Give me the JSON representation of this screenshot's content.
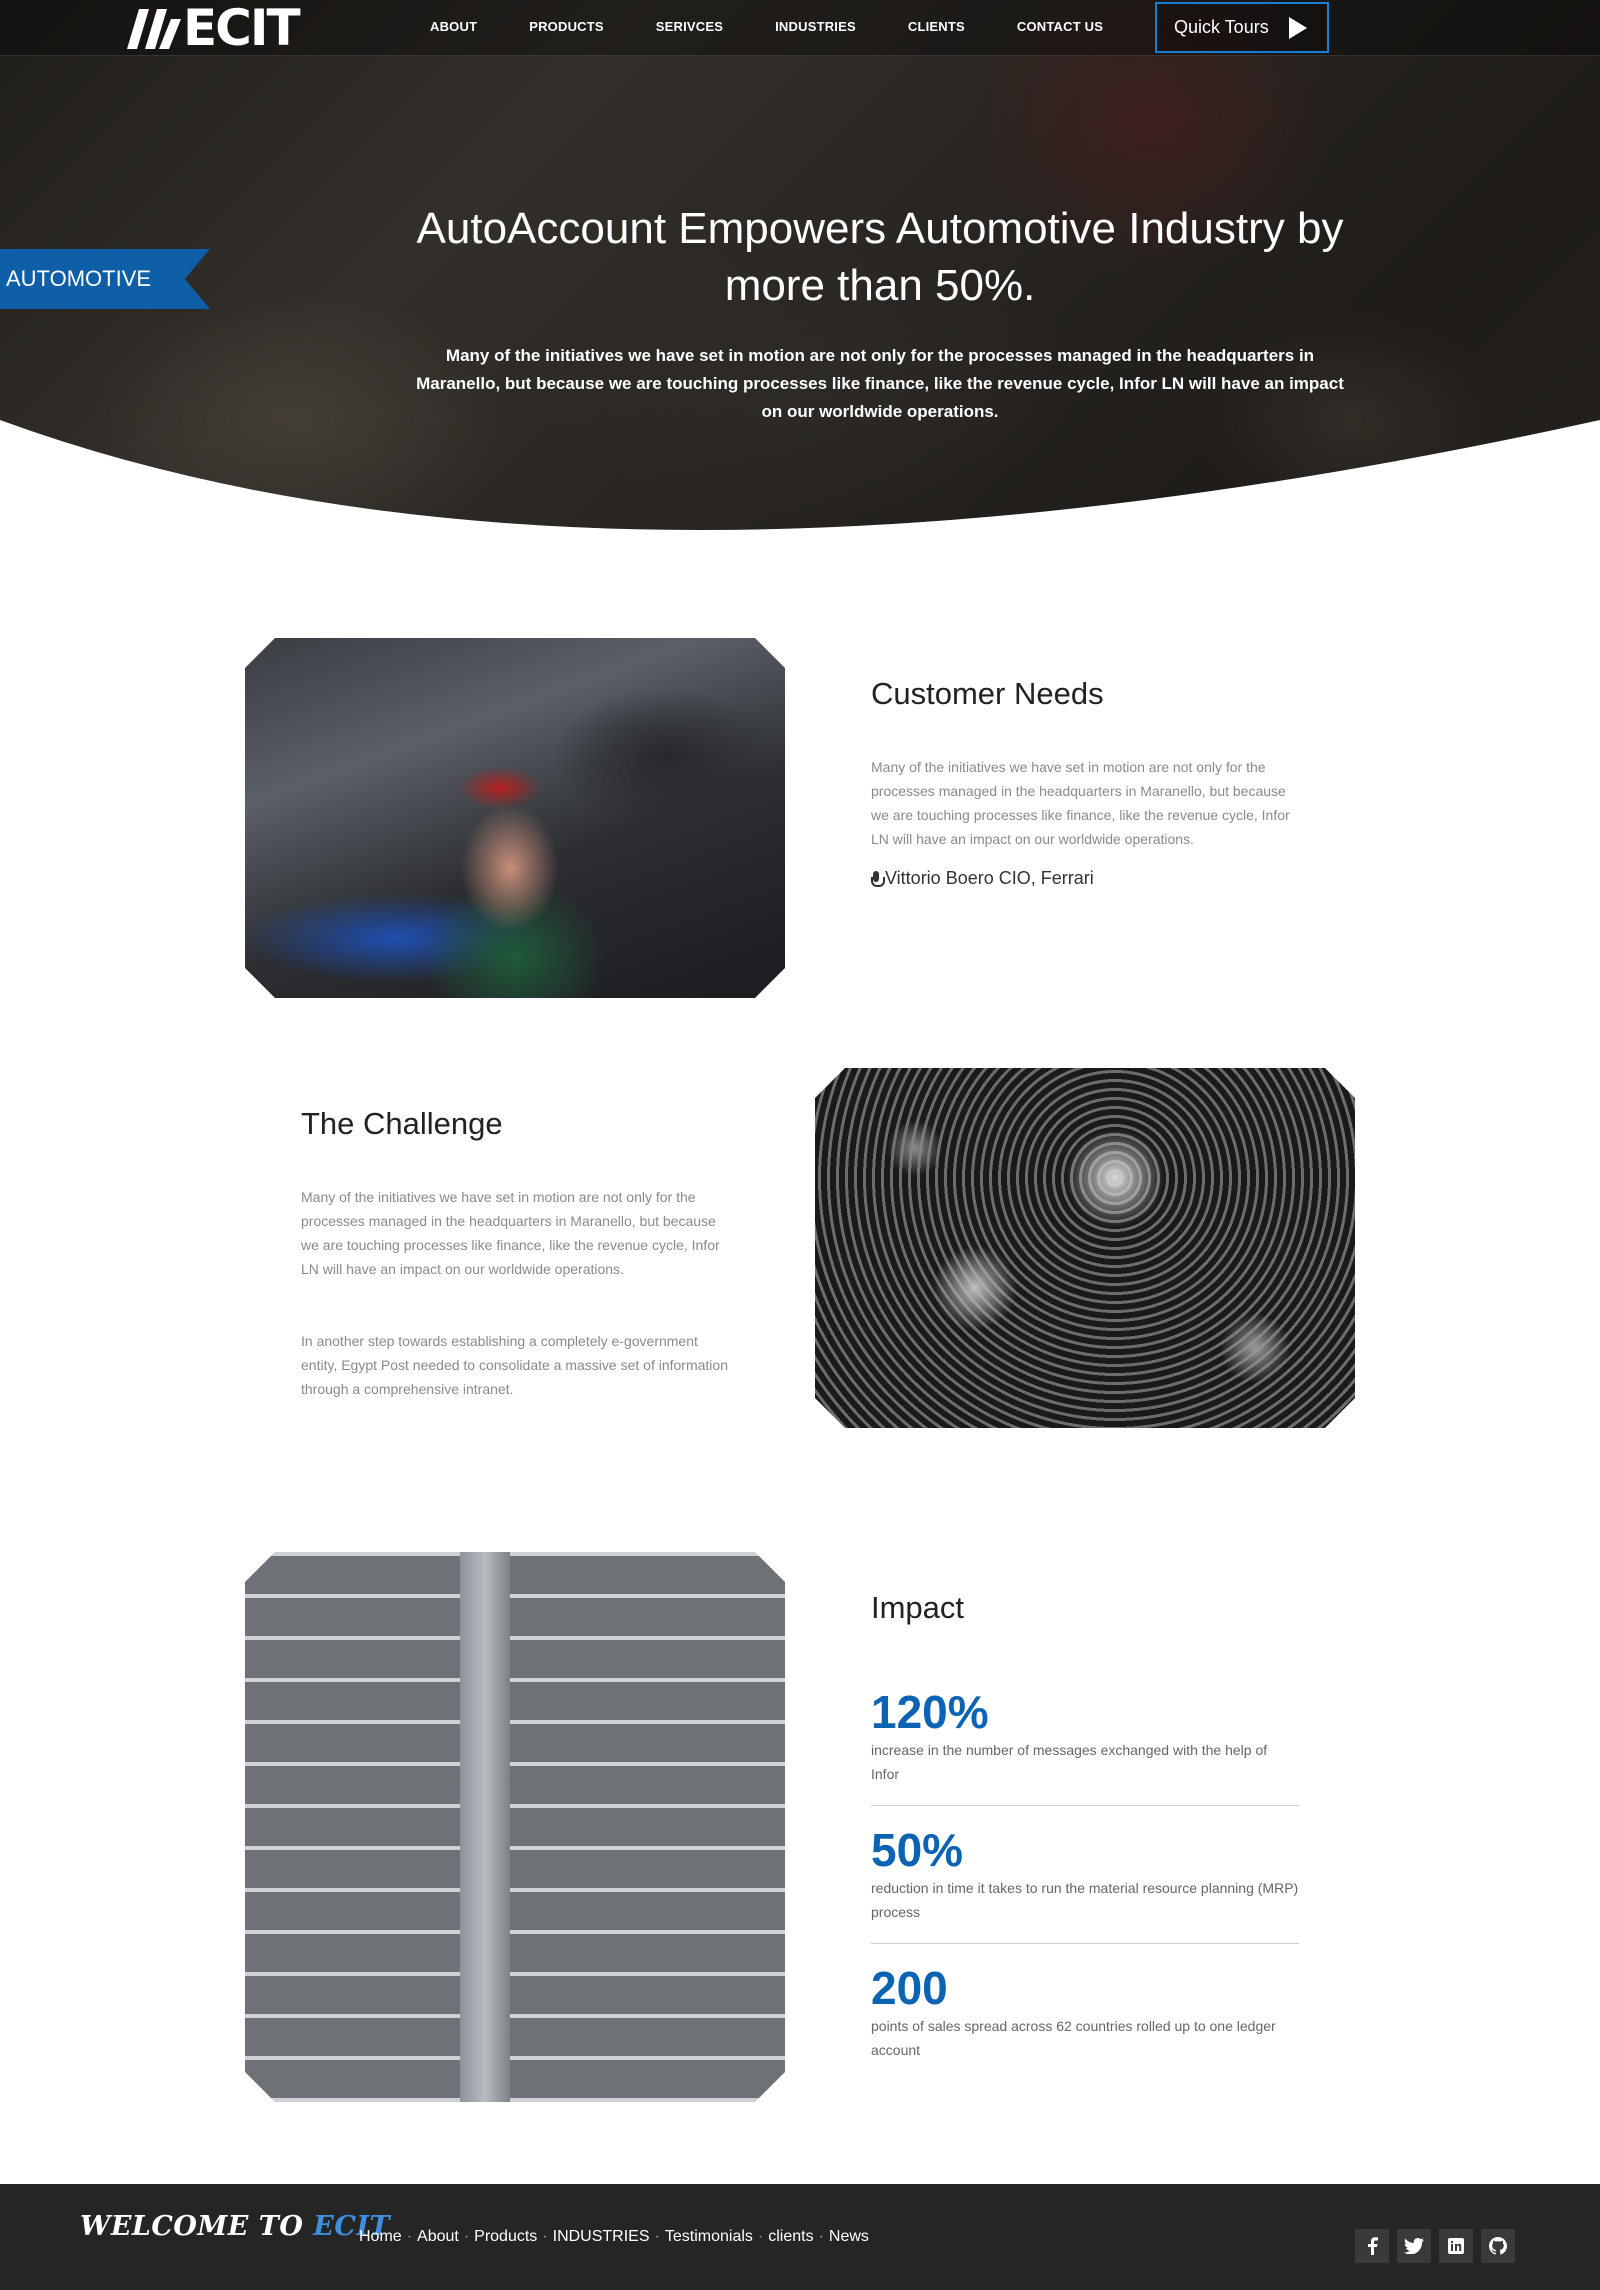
{
  "nav": {
    "logo": "ECIT",
    "links": [
      "ABOUT",
      "PRODUCTS",
      "SERIVCES",
      "INDUSTRIES",
      "CLIENTS",
      "CONTACT US"
    ],
    "cta": "Quick Tours"
  },
  "hero": {
    "ribbon": "AUTOMOTIVE",
    "title": "AutoAccount Empowers Automotive Industry by more than 50%.",
    "text": "Many of the initiatives we have set in motion are not only for the processes managed in the headquarters in Maranello, but because we are touching processes like finance, like the revenue cycle, Infor LN will have an impact on our worldwide operations."
  },
  "customer_needs": {
    "title": "Customer Needs",
    "text": "Many of the initiatives we have set in motion are not only for the processes managed in the headquarters in Maranello, but because we are touching processes like finance, like the revenue cycle, Infor LN will have an impact on our worldwide operations.",
    "quote": "Vittorio Boero CIO, Ferrari"
  },
  "challenge": {
    "title": "The Challenge",
    "text1": "Many of the initiatives we have set in motion are not only for the processes managed in the headquarters in Maranello, but because we are touching processes like finance, like the revenue cycle, Infor LN will have an impact on our worldwide operations.",
    "text2": "In another step towards establishing a completely e-government entity, Egypt Post needed to consolidate a massive set of information through a comprehensive intranet."
  },
  "impact": {
    "title": "Impact",
    "stats": [
      {
        "value": "120%",
        "desc": "increase in the number of messages exchanged with the help of Infor"
      },
      {
        "value": "50%",
        "desc": "reduction in time it takes to run the material resource planning (MRP) process"
      },
      {
        "value": "200",
        "desc": "points of sales spread across 62 countries rolled up to one ledger account"
      }
    ]
  },
  "footer": {
    "brand_prefix": "WELCOME TO",
    "brand_accent": "ECIT",
    "links": [
      "Home",
      "About",
      "Products",
      "INDUSTRIES",
      "Testimonials",
      "clients",
      "News"
    ],
    "socials": [
      "f",
      "t",
      "in",
      "gh"
    ]
  },
  "colors": {
    "accent": "#0b63b3",
    "ribbon": "#0e5fa8",
    "footer": "#252525"
  }
}
